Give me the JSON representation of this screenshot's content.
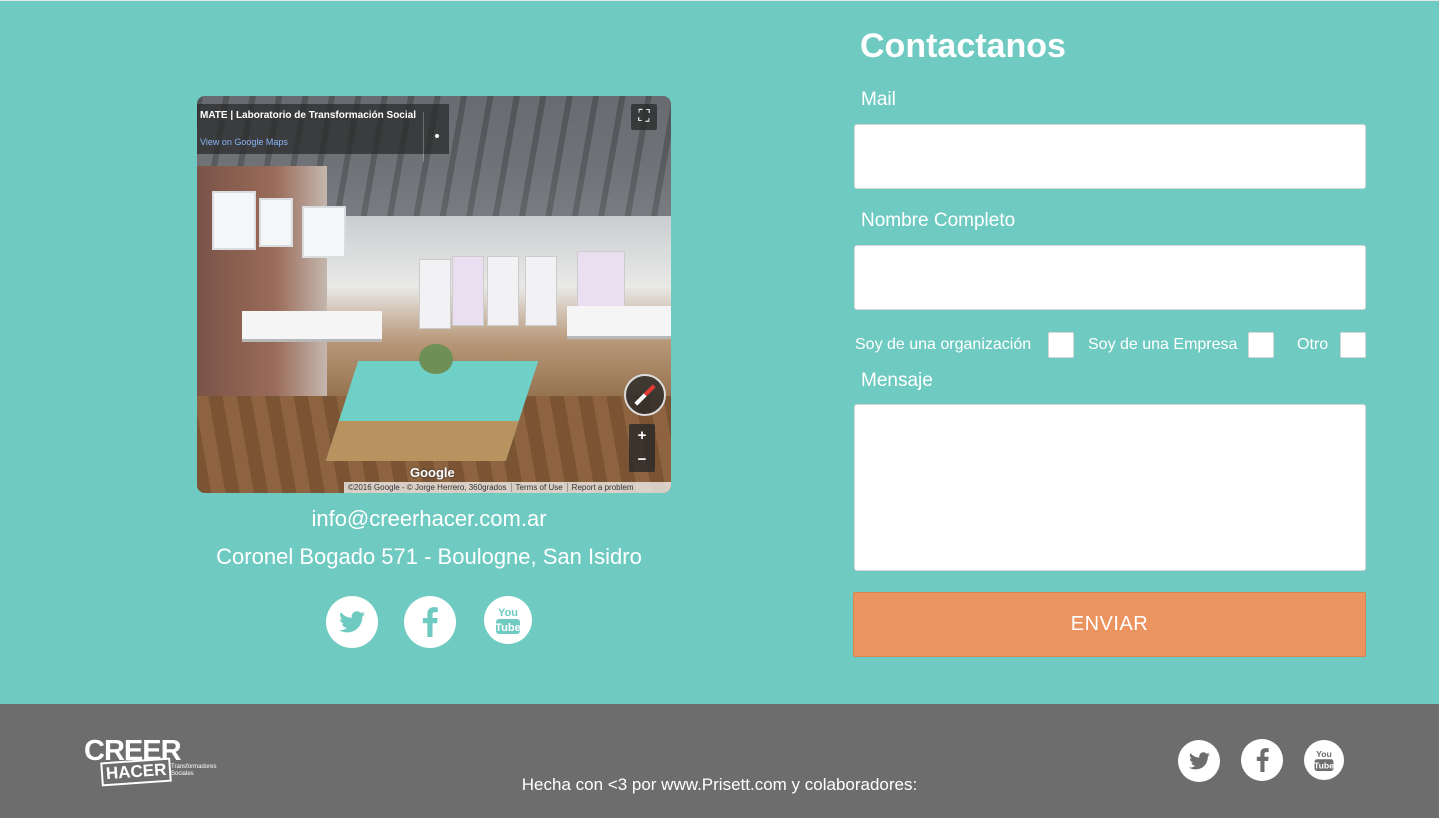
{
  "colors": {
    "main_bg": "#6fcac1",
    "footer_bg": "#6d6d6d",
    "submit_bg": "#ec9460",
    "icon_color": "#6fcac1"
  },
  "map": {
    "place_title": "MATE | Laboratorio de Transformación Social",
    "view_link": "View on Google Maps",
    "google_label": "Google",
    "attribution": "©2016 Google - © Jorge Herrero, 360grados",
    "terms": "Terms of Use",
    "report": "Report a problem",
    "zoom_in": "+",
    "zoom_out": "−"
  },
  "contact": {
    "email": "info@creerhacer.com.ar",
    "address": "Coronel Bogado 571 - Boulogne, San Isidro"
  },
  "social": {
    "icons": [
      "twitter-icon",
      "facebook-icon",
      "youtube-icon"
    ],
    "youtube_you": "You",
    "youtube_tube": "Tube"
  },
  "form": {
    "title": "Contactanos",
    "mail_label": "Mail",
    "mail_value": "",
    "name_label": "Nombre Completo",
    "name_value": "",
    "options": [
      {
        "label": "Soy de una organización",
        "checked": false
      },
      {
        "label": "Soy de una Empresa",
        "checked": false
      },
      {
        "label": "Otro",
        "checked": false
      }
    ],
    "message_label": "Mensaje",
    "message_value": "",
    "submit_label": "ENVIAR"
  },
  "footer": {
    "logo_top": "CREER",
    "logo_bottom": "HACER",
    "logo_tagline": "Transformadores Sociales",
    "credit": "Hecha con <3 por www.Prisett.com y colaboradores:"
  }
}
